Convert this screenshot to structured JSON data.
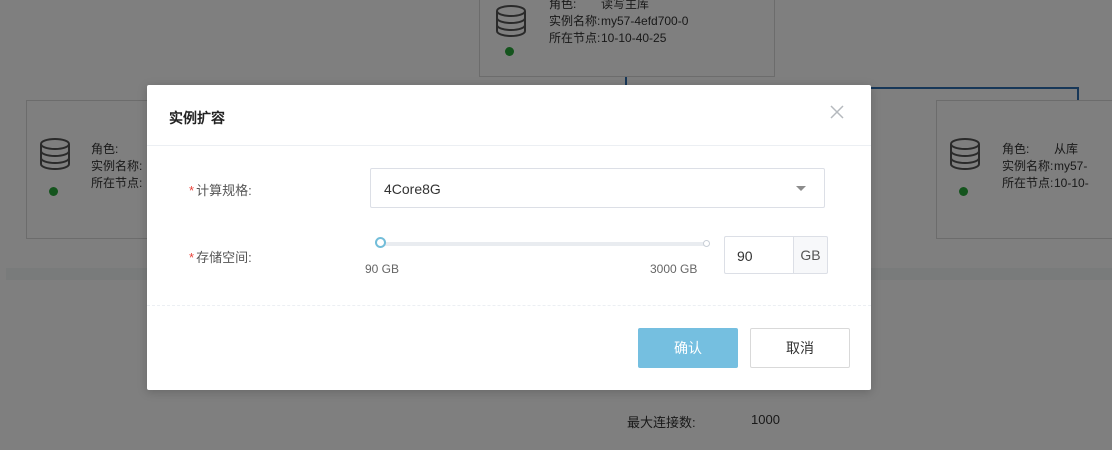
{
  "background": {
    "nodes": [
      {
        "role_key": "角色:",
        "role_val": "读写主库",
        "name_key": "实例名称:",
        "name_val": "my57-4efd700-0",
        "node_key": "所在节点:",
        "node_val": "10-10-40-25"
      },
      {
        "role_key": "角色:",
        "role_val": "",
        "name_key": "实例名称:",
        "name_val": "",
        "node_key": "所在节点:",
        "node_val": ""
      },
      {
        "role_key": "角色:",
        "role_val": "从库",
        "name_key": "实例名称:",
        "name_val": "my57-",
        "node_key": "所在节点:",
        "node_val": "10-10-"
      }
    ],
    "max_conn_label": "最大连接数:",
    "max_conn_value": "1000"
  },
  "modal": {
    "title": "实例扩容",
    "compute": {
      "label": "计算规格:",
      "value": "4Core8G"
    },
    "storage": {
      "label": "存储空间:",
      "min_label": "90 GB",
      "max_label": "3000 GB",
      "value": "90",
      "unit": "GB",
      "min": 90,
      "max": 3000
    },
    "required_mark": "*",
    "ok_label": "确认",
    "cancel_label": "取消"
  },
  "colors": {
    "accent": "#75bfe0",
    "status_ok": "#29a83a",
    "required": "#e9443b",
    "mask": "rgba(0,0,0,0.5)"
  }
}
